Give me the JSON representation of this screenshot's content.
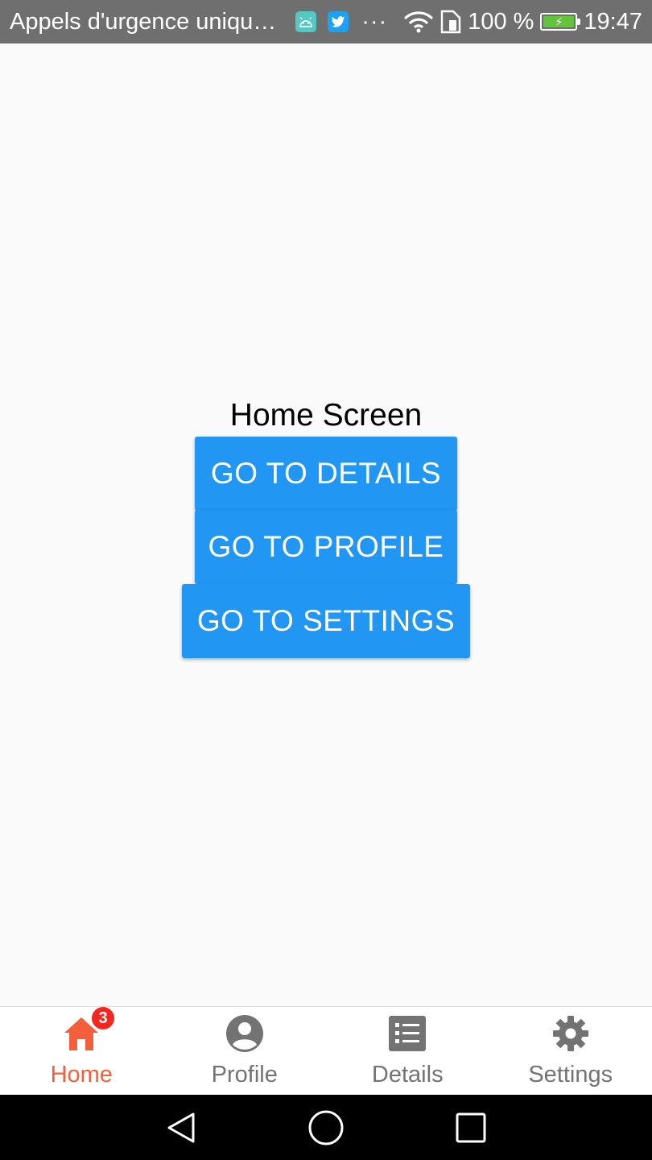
{
  "status_bar": {
    "notification_text": "Appels d'urgence uniqu…",
    "more": "···",
    "battery_percent": "100 %",
    "time": "19:47",
    "battery_level": 1.0,
    "colors": {
      "background": "#6f6f6f",
      "battery_fill": "#62c43a"
    }
  },
  "main": {
    "title": "Home Screen",
    "buttons": {
      "details": "GO TO DETAILS",
      "profile": "GO TO PROFILE",
      "settings": "GO TO SETTINGS"
    },
    "colors": {
      "button": "#2196f3"
    }
  },
  "tab_bar": {
    "tabs": [
      {
        "label": "Home",
        "icon": "home-icon",
        "active": true,
        "badge": "3"
      },
      {
        "label": "Profile",
        "icon": "account-circle-icon",
        "active": false
      },
      {
        "label": "Details",
        "icon": "list-icon",
        "active": false
      },
      {
        "label": "Settings",
        "icon": "gear-icon",
        "active": false
      }
    ],
    "colors": {
      "active": "#f45f3b",
      "inactive": "#737373",
      "badge": "#f4261d"
    }
  },
  "system_nav": {
    "keys": [
      "back-icon",
      "home-circle-icon",
      "recent-apps-icon"
    ]
  }
}
